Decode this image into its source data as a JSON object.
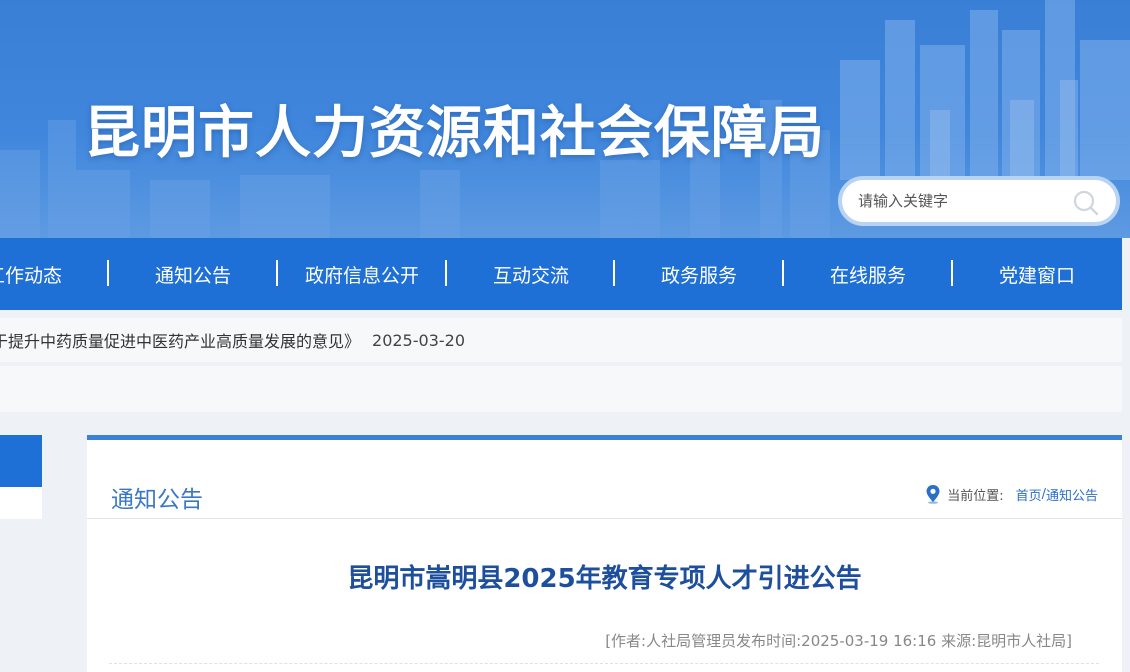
{
  "header": {
    "site_title": "昆明市人力资源和社会保障局",
    "search_placeholder": "请输入关键字"
  },
  "nav": {
    "items": [
      {
        "label": "工作动态"
      },
      {
        "label": "通知公告"
      },
      {
        "label": "政府信息公开"
      },
      {
        "label": "互动交流"
      },
      {
        "label": "政务服务"
      },
      {
        "label": "在线服务"
      },
      {
        "label": "党建窗口"
      }
    ]
  },
  "ticker": {
    "text": "于提升中药质量促进中医药产业高质量发展的意见》",
    "date": "2025-03-20"
  },
  "panel": {
    "title": "通知公告",
    "breadcrumb": {
      "label": "当前位置:",
      "home": "首页",
      "separator": "/",
      "current": "通知公告"
    },
    "article": {
      "title": "昆明市嵩明县2025年教育专项人才引进公告",
      "meta": "[作者:人社局管理员发布时间:2025-03-19 16:16 来源:昆明市人社局]"
    }
  },
  "colors": {
    "banner_blue": "#3f86dc",
    "nav_blue": "#1e6fd6",
    "title_blue": "#1d4f9c",
    "link_blue": "#2a6fc9"
  }
}
